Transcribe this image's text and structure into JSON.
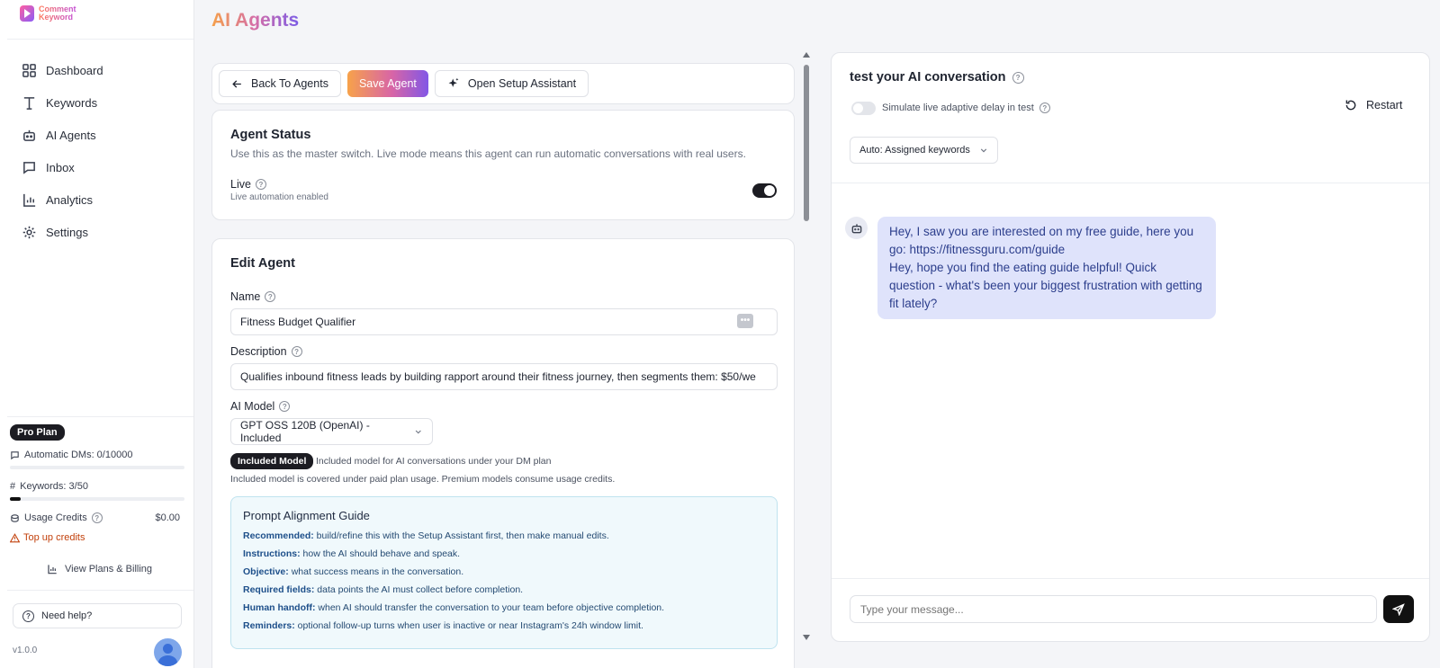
{
  "brand": {
    "line1": "Comment",
    "line2": "Keyword"
  },
  "sidebar": {
    "items": [
      {
        "label": "Dashboard",
        "icon": "grid-icon"
      },
      {
        "label": "Keywords",
        "icon": "text-icon"
      },
      {
        "label": "AI Agents",
        "icon": "robot-icon"
      },
      {
        "label": "Inbox",
        "icon": "chat-icon"
      },
      {
        "label": "Analytics",
        "icon": "bar-chart-icon"
      },
      {
        "label": "Settings",
        "icon": "gear-icon"
      }
    ],
    "plan": "Pro Plan",
    "dms_label": "Automatic DMs: 0/10000",
    "dms_progress": 0,
    "keywords_label": "Keywords: 3/50",
    "keywords_progress": 0.06,
    "credits_label": "Usage Credits",
    "credits_value": "$0.00",
    "topup": "Top up credits",
    "billing": "View Plans & Billing",
    "help": "Need help?",
    "version": "v1.0.0"
  },
  "page": {
    "title": "AI Agents"
  },
  "toolbar": {
    "back": "Back To Agents",
    "save": "Save Agent",
    "assistant": "Open Setup Assistant"
  },
  "status": {
    "title": "Agent Status",
    "desc": "Use this as the master switch. Live mode means this agent can run automatic conversations with real users.",
    "live_label": "Live",
    "live_sub": "Live automation enabled",
    "live_on": true
  },
  "edit": {
    "title": "Edit Agent",
    "name_label": "Name",
    "name_value": "Fitness Budget Qualifier",
    "desc_label": "Description",
    "desc_value": "Qualifies inbound fitness leads by building rapport around their fitness journey, then segments them: $50/we",
    "model_label": "AI Model",
    "model_value": "GPT OSS 120B (OpenAI) - Included",
    "chip": "Included Model",
    "chip_note": "Included model for AI conversations under your DM plan",
    "model_note": "Included model is covered under paid plan usage. Premium models consume usage credits.",
    "guide": {
      "title": "Prompt Alignment Guide",
      "lines": [
        {
          "k": "Recommended:",
          "v": " build/refine this with the Setup Assistant first, then make manual edits."
        },
        {
          "k": "Instructions:",
          "v": " how the AI should behave and speak."
        },
        {
          "k": "Objective:",
          "v": " what success means in the conversation."
        },
        {
          "k": "Required fields:",
          "v": " data points the AI must collect before completion."
        },
        {
          "k": "Human handoff:",
          "v": " when AI should transfer the conversation to your team before objective completion."
        },
        {
          "k": "Reminders:",
          "v": " optional follow-up turns when user is inactive or near Instagram's 24h window limit."
        }
      ]
    }
  },
  "chat": {
    "title": "test your AI conversation",
    "simulate": "Simulate live adaptive delay in test",
    "restart": "Restart",
    "dropdown": "Auto: Assigned keywords",
    "message_lines": [
      "Hey, I saw you are interested on my free guide, here you go: https://fitnessguru.com/guide",
      "Hey, hope you find the eating guide helpful! Quick question - what's been your biggest frustration with getting fit lately?"
    ],
    "input_placeholder": "Type your message..."
  }
}
